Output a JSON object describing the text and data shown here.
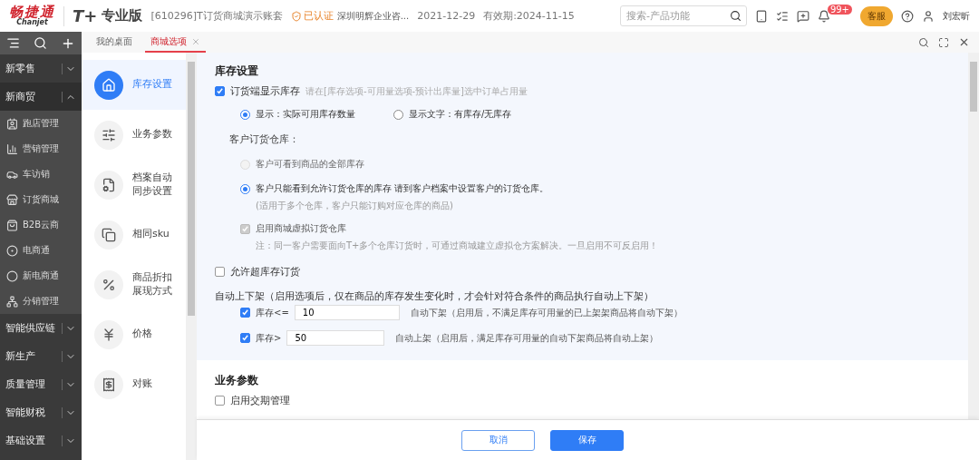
{
  "header": {
    "logo": "畅捷通",
    "logo_sub": "Chanjet",
    "product": "T+",
    "edition": "专业版",
    "account": "[610296]T订货商城演示账套",
    "certified": "已认证",
    "company": "深圳明辉企业咨...",
    "date": "2021-12-29",
    "expiry": "有效期:2024-11-15",
    "search": {
      "placeholder": "搜索-产品功能"
    },
    "badge": "99+",
    "service": "客服",
    "user": "刘宏昕"
  },
  "sidebar": {
    "groups": [
      {
        "label": "新零售",
        "expanded": false
      },
      {
        "label": "新商贸",
        "expanded": true,
        "children": [
          {
            "label": "跑店管理"
          },
          {
            "label": "营销管理"
          },
          {
            "label": "车访销"
          },
          {
            "label": "订货商城"
          },
          {
            "label": "B2B云商"
          },
          {
            "label": "电商通"
          },
          {
            "label": "新电商通"
          },
          {
            "label": "分销管理"
          }
        ]
      },
      {
        "label": "智能供应链",
        "expanded": false
      },
      {
        "label": "新生产",
        "expanded": false
      },
      {
        "label": "质量管理",
        "expanded": false
      },
      {
        "label": "智能财税",
        "expanded": false
      },
      {
        "label": "基础设置",
        "expanded": false
      }
    ]
  },
  "tabs": [
    {
      "label": "我的桌面",
      "selected": false,
      "closable": false
    },
    {
      "label": "商城选项",
      "selected": true,
      "closable": true
    }
  ],
  "settings_nav": [
    {
      "label": "库存设置",
      "selected": true
    },
    {
      "label": "业务参数",
      "selected": false
    },
    {
      "label": "档案自动同步设置",
      "selected": false
    },
    {
      "label": "相同sku",
      "selected": false
    },
    {
      "label": "商品折扣展现方式",
      "selected": false
    },
    {
      "label": "价格",
      "selected": false
    },
    {
      "label": "对账",
      "selected": false
    }
  ],
  "inventory": {
    "title": "库存设置",
    "show_stock": {
      "label": "订货端显示库存",
      "checked": true,
      "hint": "请在[库存选项-可用量选项-预计出库量]选中订单占用量"
    },
    "display_options": [
      {
        "label": "显示：实际可用库存数量",
        "selected": true
      },
      {
        "label": "显示文字：有库存/无库存",
        "selected": false
      }
    ],
    "warehouse_label": "客户订货仓库：",
    "warehouse_options": [
      {
        "label": "客户可看到商品的全部库存",
        "selected": false,
        "disabled": true
      },
      {
        "label": "客户只能看到允许订货仓库的库存 请到客户档案中设置客户的订货仓库。",
        "selected": true,
        "disabled": false,
        "note": "(适用于多个仓库，客户只能订购对应仓库的商品)"
      }
    ],
    "virtual_warehouse": {
      "label": "启用商城虚拟订货仓库",
      "checked": true,
      "disabled": true,
      "note": "注：同一客户需要面向T+多个仓库订货时，可通过商城建立虚拟仓方案解决。一旦启用不可反启用！"
    },
    "over_stock": {
      "label": "允许超库存订货",
      "checked": false
    },
    "auto_title": "自动上下架（启用选项后，仅在商品的库存发生变化时，才会针对符合条件的商品执行自动上下架）",
    "auto_rules": [
      {
        "label": "库存<=",
        "value": "10",
        "checked": true,
        "desc": "自动下架（启用后，不满足库存可用量的已上架架商品将自动下架）"
      },
      {
        "label": "库存>",
        "value": "50",
        "checked": true,
        "desc": "自动上架（启用后，满足库存可用量的自动下架商品将自动上架）"
      }
    ]
  },
  "business": {
    "title": "业务参数",
    "delivery": {
      "label": "启用交期管理",
      "checked": false
    }
  },
  "buttons": [
    {
      "label": "取消",
      "kind": "secondary"
    },
    {
      "label": "保存",
      "kind": "primary"
    }
  ]
}
